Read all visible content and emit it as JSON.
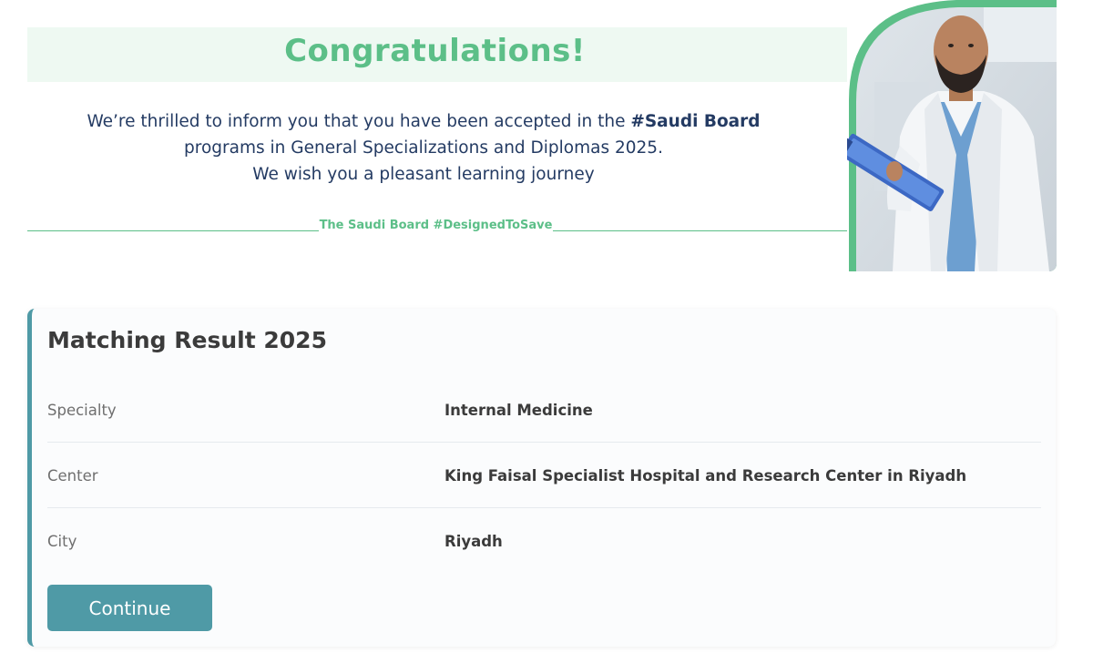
{
  "banner": {
    "heading": "Congratulations!",
    "message_line1_prefix": "We’re thrilled to inform you that you have been accepted in the ",
    "message_line1_tag": "#Saudi Board",
    "message_line2": "programs in General Specializations and Diplomas 2025.",
    "message_line3": "We wish you a pleasant learning journey",
    "motto": "The Saudi Board #DesignedToSave",
    "accent_color": "#5cbf88",
    "text_color": "#243b63"
  },
  "result": {
    "title": "Matching Result 2025",
    "rows": [
      {
        "label": "Specialty",
        "value": "Internal Medicine"
      },
      {
        "label": "Center",
        "value": "King Faisal Specialist Hospital and Research Center in Riyadh"
      },
      {
        "label": "City",
        "value": "Riyadh"
      }
    ],
    "continue_label": "Continue",
    "button_color": "#4f9aa6"
  },
  "illustration": {
    "icon": "doctor-with-clipboard-photo"
  }
}
